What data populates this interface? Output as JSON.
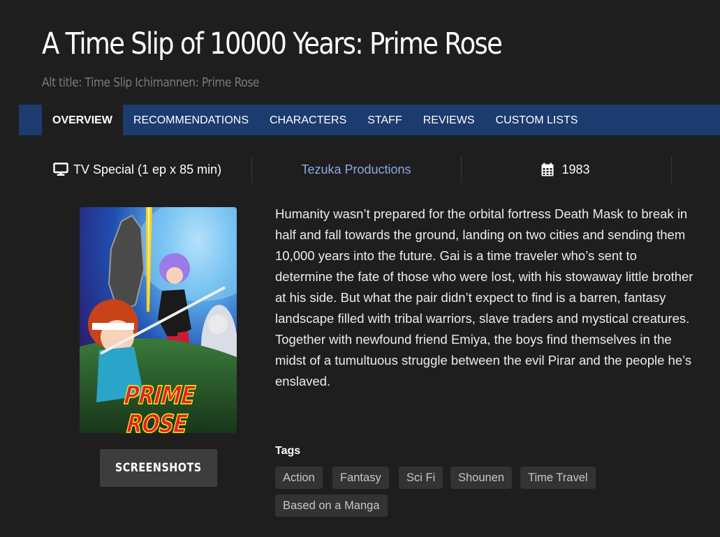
{
  "title": "A Time Slip of 10000 Years: Prime Rose",
  "alt_title": "Alt title: Time Slip Ichimannen: Prime Rose",
  "nav": {
    "tabs": [
      {
        "label": "OVERVIEW",
        "active": true
      },
      {
        "label": "RECOMMENDATIONS"
      },
      {
        "label": "CHARACTERS"
      },
      {
        "label": "STAFF"
      },
      {
        "label": "REVIEWS"
      },
      {
        "label": "CUSTOM LISTS"
      }
    ]
  },
  "info": {
    "type": "TV Special (1 ep x 85 min)",
    "type_icon": "monitor-icon",
    "studio": "Tezuka Productions",
    "year": "1983",
    "year_icon": "calendar-icon"
  },
  "poster": {
    "title_text": "PRIME ROSE"
  },
  "screenshots_button": "SCREENSHOTS",
  "synopsis": "Humanity wasn’t prepared for the orbital fortress Death Mask to break in half and fall towards the ground, landing on two cities and sending them 10,000 years into the future. Gai is a time traveler who’s sent to determine the fate of those who were lost, with his stowaway little brother at his side. But what the pair didn’t expect to find is a barren, fantasy landscape filled with tribal warriors, slave traders and mystical creatures. Together with newfound friend Emiya, the boys find themselves in the midst of a tumultuous struggle between the evil Pirar and the people he’s enslaved.",
  "tags": {
    "label": "Tags",
    "items": [
      "Action",
      "Fantasy",
      "Sci Fi",
      "Shounen",
      "Time Travel",
      "Based on a Manga"
    ]
  },
  "colors": {
    "background": "#1e1e1e",
    "nav_bar": "#1c3b6e",
    "link": "#8fa6e6",
    "tag_bg": "#333333",
    "button_bg": "#3d3d3d"
  }
}
